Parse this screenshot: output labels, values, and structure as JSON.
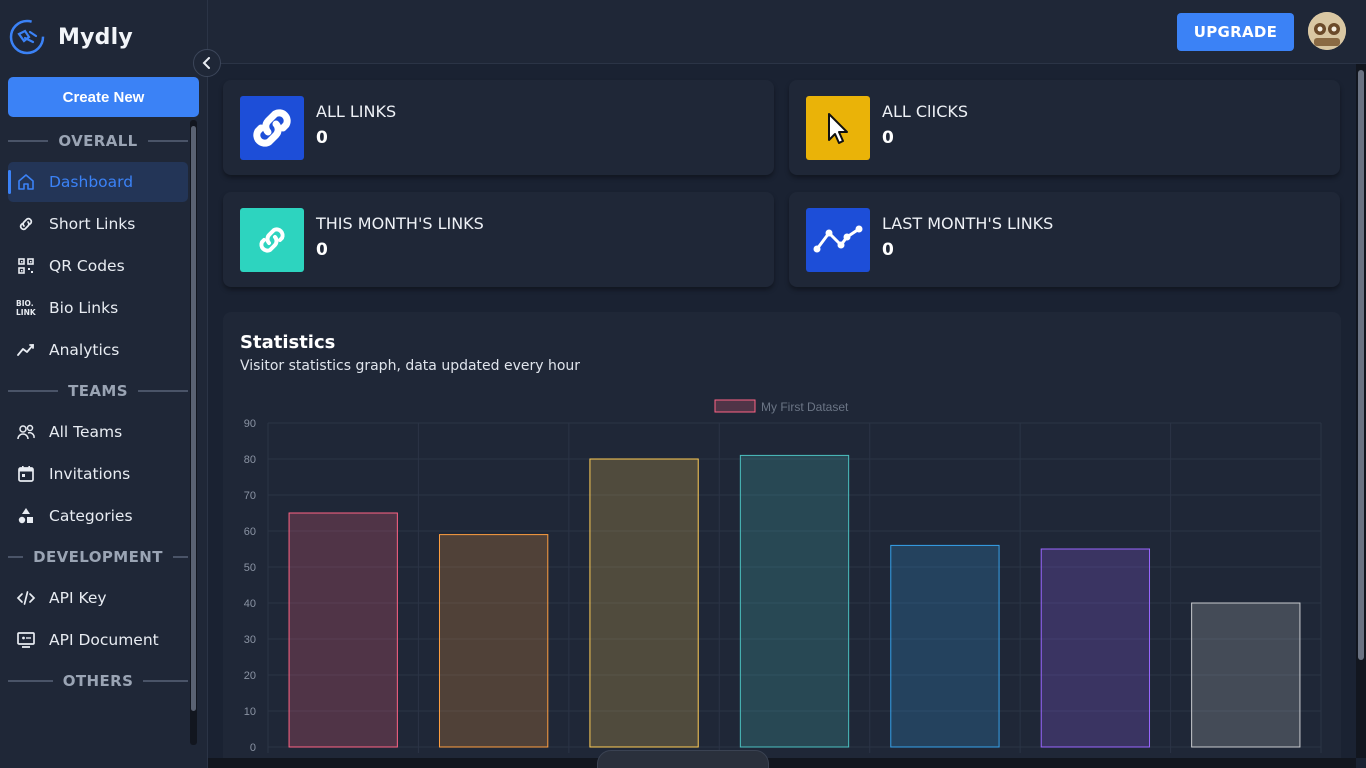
{
  "app": {
    "name": "Mydly"
  },
  "sidebar": {
    "create_label": "Create New",
    "sections": [
      {
        "title": "OVERALL",
        "items": [
          {
            "label": "Dashboard",
            "icon": "home-icon",
            "active": true
          },
          {
            "label": "Short Links",
            "icon": "link-icon"
          },
          {
            "label": "QR Codes",
            "icon": "qr-code-icon"
          },
          {
            "label": "Bio Links",
            "icon": "bio-link-icon"
          },
          {
            "label": "Analytics",
            "icon": "trend-icon"
          }
        ]
      },
      {
        "title": "TEAMS",
        "items": [
          {
            "label": "All Teams",
            "icon": "users-icon"
          },
          {
            "label": "Invitations",
            "icon": "calendar-icon"
          },
          {
            "label": "Categories",
            "icon": "shapes-icon"
          }
        ]
      },
      {
        "title": "DEVELOPMENT",
        "items": [
          {
            "label": "API Key",
            "icon": "code-icon"
          },
          {
            "label": "API Document",
            "icon": "monitor-icon"
          }
        ]
      },
      {
        "title": "OTHERS",
        "items": []
      }
    ]
  },
  "topbar": {
    "upgrade_label": "UPGRADE"
  },
  "cards": [
    {
      "label": "ALL LINKS",
      "value": "0",
      "color": "#1d4ed8",
      "icon": "link-icon"
    },
    {
      "label": "ALL ClICKS",
      "value": "0",
      "color": "#eab308",
      "icon": "cursor-icon"
    },
    {
      "label": "THIS MONTH'S LINKS",
      "value": "0",
      "color": "#2dd4bf",
      "icon": "link-icon"
    },
    {
      "label": "LAST MONTH'S LINKS",
      "value": "0",
      "color": "#1d4ed8",
      "icon": "trend-icon"
    }
  ],
  "statistics": {
    "title": "Statistics",
    "subtitle": "Visitor statistics graph, data updated every hour"
  },
  "chart_data": {
    "type": "bar",
    "legend": "top",
    "grid": true,
    "ylim": [
      0,
      90
    ],
    "yticks": [
      "0",
      "10",
      "20",
      "30",
      "40",
      "50",
      "60",
      "70",
      "80",
      "90"
    ],
    "series": [
      {
        "name": "My First Dataset",
        "values": [
          65,
          59,
          80,
          81,
          56,
          55,
          40
        ]
      }
    ],
    "bar_colors": [
      "#ff6384",
      "#ff9f40",
      "#ffcd56",
      "#4bc0c0",
      "#36a2eb",
      "#9966ff",
      "#c9cbcf"
    ]
  }
}
